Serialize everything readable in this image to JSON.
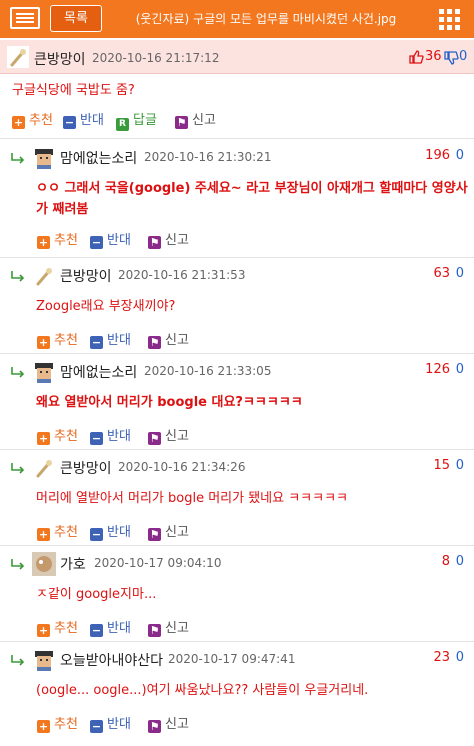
{
  "header": {
    "list_label": "목록",
    "title": "(웃긴자료) 구글의 모든 업무를 마비시켰던 사건.jpg"
  },
  "post": {
    "author": "큰방망이",
    "datetime": "2020-10-16 21:17:12",
    "up": "36",
    "down": "0",
    "text": "구글식당에 국밥도 줌?",
    "actions": {
      "recommend": "추천",
      "oppose": "반대",
      "reply": "답글",
      "report": "신고"
    }
  },
  "comments": [
    {
      "author": "맘에없는소리",
      "datetime": "2020-10-16 21:30:21",
      "up": "196",
      "down": "0",
      "lines": [
        "ㅇㅇ 그래서 국을(google) 주세요~ 라고 부장님이 아재개그 할때마다 영양사",
        "가 째려봄"
      ],
      "bold": true,
      "avatar": "pixel"
    },
    {
      "author": "큰방망이",
      "datetime": "2020-10-16 21:31:53",
      "up": "63",
      "down": "0",
      "lines": [
        "Zoogle래요 부장새끼야?"
      ],
      "bold": false,
      "avatar": "bat"
    },
    {
      "author": "맘에없는소리",
      "datetime": "2020-10-16 21:33:05",
      "up": "126",
      "down": "0",
      "lines": [
        "왜요 열받아서 머리가 boogle 대요?ㅋㅋㅋㅋㅋ"
      ],
      "bold": true,
      "avatar": "pixel"
    },
    {
      "author": "큰방망이",
      "datetime": "2020-10-16 21:34:26",
      "up": "15",
      "down": "0",
      "lines": [
        "머리에 열받아서 머리가 bogle 머리가 됐네요 ㅋㅋㅋㅋㅋ"
      ],
      "bold": false,
      "avatar": "bat"
    },
    {
      "author": "가호",
      "datetime": "2020-10-17 09:04:10",
      "up": "8",
      "down": "0",
      "lines": [
        "ㅈ같이 google지마..."
      ],
      "bold": false,
      "avatar": "photo"
    },
    {
      "author": "오늘받아내야산다",
      "datetime": "2020-10-17 09:47:41",
      "up": "23",
      "down": "0",
      "lines": [
        "(oogle... oogle...)여기 싸움났나요?? 사람들이 우글거리네."
      ],
      "bold": false,
      "avatar": "pixel"
    }
  ],
  "comment_actions": {
    "recommend": "추천",
    "oppose": "반대",
    "report": "신고"
  },
  "colors": {
    "accent": "#f2771f",
    "red_text": "#dd1111",
    "blue": "#2360c9",
    "post_bg": "#fde3e0"
  },
  "icons": [
    "menu-icon",
    "grid-icon",
    "thumbs-up-icon",
    "thumbs-down-icon",
    "reply-arrow-icon",
    "report-icon"
  ]
}
